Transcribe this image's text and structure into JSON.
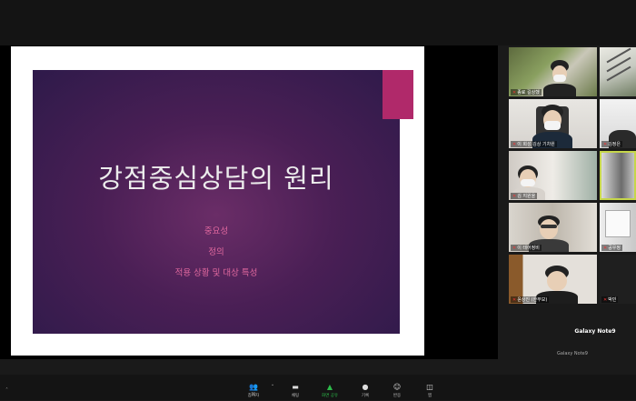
{
  "slide": {
    "title": "강점중심상담의 원리",
    "bullets": [
      "중요성",
      "정의",
      "적용 상황 및 대상 특성"
    ],
    "colors": {
      "accent_tab": "#b0296a",
      "bullet_text": "#e0689e"
    }
  },
  "gallery": {
    "tiles": [
      {
        "label": "종료 길상했"
      },
      {
        "label": ""
      },
      {
        "label": "이 회성 김상 기차원"
      },
      {
        "label": "김정은"
      },
      {
        "label": "김 지원을"
      },
      {
        "label": ""
      },
      {
        "label": "이 태어정비"
      },
      {
        "label": "공우정"
      },
      {
        "label": "윤상진 (한부모)"
      },
      {
        "label": "박민"
      }
    ],
    "device_tile": {
      "name": "Galaxy Note9",
      "sub": "Galaxy Note9"
    }
  },
  "toolbar": {
    "items": [
      {
        "label": "참가자",
        "icon": "participants-icon",
        "count": "31"
      },
      {
        "label": "채팅",
        "icon": "chat-icon"
      },
      {
        "label": "화면 공유",
        "icon": "share-screen-icon"
      },
      {
        "label": "기록",
        "icon": "record-icon"
      },
      {
        "label": "반응",
        "icon": "reactions-icon"
      },
      {
        "label": "앱",
        "icon": "apps-icon"
      }
    ]
  }
}
